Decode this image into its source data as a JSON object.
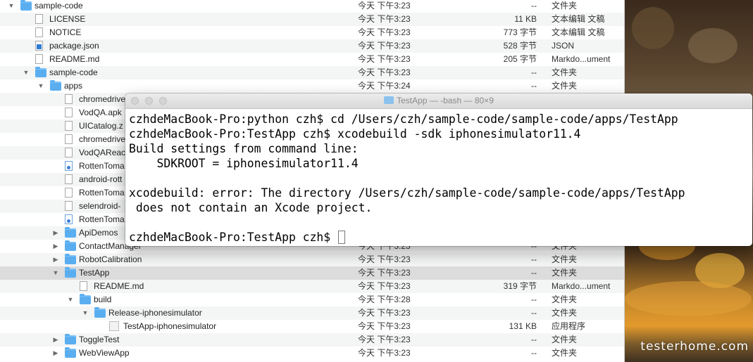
{
  "finder": {
    "rows": [
      {
        "indent": 0,
        "tri": "▼",
        "icon": "folder",
        "name": "sample-code",
        "date": "今天 下午3:23",
        "size": "--",
        "kind": "文件夹"
      },
      {
        "indent": 1,
        "tri": "",
        "icon": "doc",
        "name": "LICENSE",
        "date": "今天 下午3:23",
        "size": "11 KB",
        "kind": "文本编辑 文稿"
      },
      {
        "indent": 1,
        "tri": "",
        "icon": "doc",
        "name": "NOTICE",
        "date": "今天 下午3:23",
        "size": "773 字节",
        "kind": "文本编辑 文稿"
      },
      {
        "indent": 1,
        "tri": "",
        "icon": "vsc",
        "name": "package.json",
        "date": "今天 下午3:23",
        "size": "528 字节",
        "kind": "JSON"
      },
      {
        "indent": 1,
        "tri": "",
        "icon": "doc",
        "name": "README.md",
        "date": "今天 下午3:23",
        "size": "205 字节",
        "kind": "Markdo...ument"
      },
      {
        "indent": 1,
        "tri": "▼",
        "icon": "folder",
        "name": "sample-code",
        "date": "今天 下午3:23",
        "size": "--",
        "kind": "文件夹"
      },
      {
        "indent": 2,
        "tri": "▼",
        "icon": "folder",
        "name": "apps",
        "date": "今天 下午3:24",
        "size": "--",
        "kind": "文件夹"
      },
      {
        "indent": 3,
        "tri": "",
        "icon": "doc",
        "name": "chromedrive",
        "date": "",
        "size": "",
        "kind": ""
      },
      {
        "indent": 3,
        "tri": "",
        "icon": "doc",
        "name": "VodQA.apk",
        "date": "",
        "size": "",
        "kind": ""
      },
      {
        "indent": 3,
        "tri": "",
        "icon": "doc",
        "name": "UICatalog.z",
        "date": "",
        "size": "",
        "kind": ""
      },
      {
        "indent": 3,
        "tri": "",
        "icon": "doc",
        "name": "chromedrive",
        "date": "",
        "size": "",
        "kind": ""
      },
      {
        "indent": 3,
        "tri": "",
        "icon": "doc",
        "name": "VodQAReac",
        "date": "",
        "size": "",
        "kind": ""
      },
      {
        "indent": 3,
        "tri": "",
        "icon": "blue",
        "name": "RottenToma",
        "date": "",
        "size": "",
        "kind": ""
      },
      {
        "indent": 3,
        "tri": "",
        "icon": "doc",
        "name": "android-rott",
        "date": "",
        "size": "",
        "kind": ""
      },
      {
        "indent": 3,
        "tri": "",
        "icon": "doc",
        "name": "RottenToma",
        "date": "",
        "size": "",
        "kind": ""
      },
      {
        "indent": 3,
        "tri": "",
        "icon": "doc",
        "name": "selendroid-",
        "date": "",
        "size": "",
        "kind": ""
      },
      {
        "indent": 3,
        "tri": "",
        "icon": "blue",
        "name": "RottenToma",
        "date": "",
        "size": "",
        "kind": ""
      },
      {
        "indent": 3,
        "tri": "▶",
        "icon": "folder",
        "name": "ApiDemos",
        "date": "",
        "size": "",
        "kind": ""
      },
      {
        "indent": 3,
        "tri": "▶",
        "icon": "folder",
        "name": "ContactManager",
        "date": "今天 下午3:23",
        "size": "--",
        "kind": "文件夹"
      },
      {
        "indent": 3,
        "tri": "▶",
        "icon": "folder",
        "name": "RobotCalibration",
        "date": "今天 下午3:23",
        "size": "--",
        "kind": "文件夹"
      },
      {
        "indent": 3,
        "tri": "▼",
        "icon": "folder",
        "name": "TestApp",
        "date": "今天 下午3:23",
        "size": "--",
        "kind": "文件夹",
        "selected": true
      },
      {
        "indent": 4,
        "tri": "",
        "icon": "doc",
        "name": "README.md",
        "date": "今天 下午3:23",
        "size": "319 字节",
        "kind": "Markdo...ument"
      },
      {
        "indent": 4,
        "tri": "▼",
        "icon": "folder",
        "name": "build",
        "date": "今天 下午3:28",
        "size": "--",
        "kind": "文件夹"
      },
      {
        "indent": 5,
        "tri": "▼",
        "icon": "folder",
        "name": "Release-iphonesimulator",
        "date": "今天 下午3:23",
        "size": "--",
        "kind": "文件夹"
      },
      {
        "indent": 6,
        "tri": "",
        "icon": "app",
        "name": "TestApp-iphonesimulator",
        "date": "今天 下午3:23",
        "size": "131 KB",
        "kind": "应用程序"
      },
      {
        "indent": 3,
        "tri": "▶",
        "icon": "folder",
        "name": "ToggleTest",
        "date": "今天 下午3:23",
        "size": "--",
        "kind": "文件夹"
      },
      {
        "indent": 3,
        "tri": "▶",
        "icon": "folder",
        "name": "WebViewApp",
        "date": "今天 下午3:23",
        "size": "--",
        "kind": "文件夹"
      }
    ]
  },
  "terminal": {
    "title": "TestApp — -bash — 80×9",
    "lines": [
      "czhdeMacBook-Pro:python czh$ cd /Users/czh/sample-code/sample-code/apps/TestApp",
      "czhdeMacBook-Pro:TestApp czh$ xcodebuild -sdk iphonesimulator11.4",
      "Build settings from command line:",
      "    SDKROOT = iphonesimulator11.4",
      "",
      "xcodebuild: error: The directory /Users/czh/sample-code/sample-code/apps/TestApp",
      " does not contain an Xcode project.",
      ""
    ],
    "prompt": "czhdeMacBook-Pro:TestApp czh$ "
  },
  "watermark": "testerhome.com",
  "colors": {
    "folder": "#5aaef0",
    "selection": "#dcdcdc"
  }
}
